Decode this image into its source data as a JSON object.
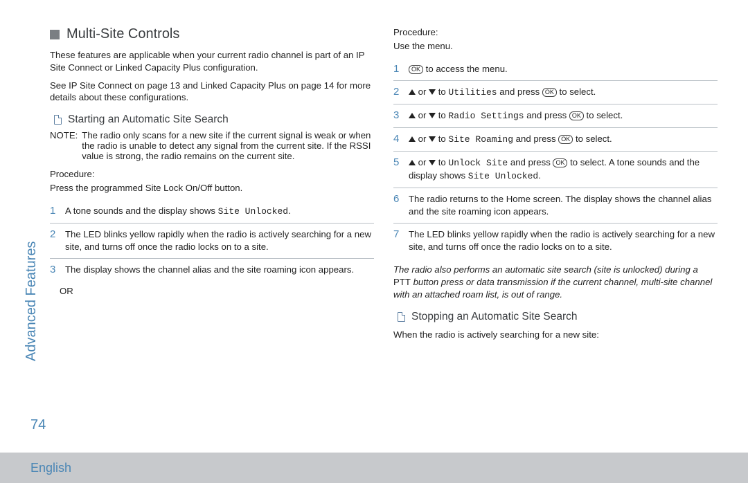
{
  "sidebar_label": "Advanced Features",
  "page_number": "74",
  "footer_language": "English",
  "left": {
    "section_title": "Multi-Site Controls",
    "intro": "These features are applicable when your current radio channel is part of an IP Site Connect or Linked Capacity Plus configuration.",
    "see": "See IP Site Connect   on page 13 and Linked Capacity Plus    on page 14 for more details about these configurations.",
    "sub1_title": "Starting an Automatic Site Search",
    "note_label": "NOTE:",
    "note_text": "The radio only  scans for a new site if the current signal is weak or when the radio is unable to detect any signal from the current site. If the RSSI value is strong, the radio remains on the current site.",
    "procedure_label": "Procedure:",
    "press_line": "Press the programmed Site Lock On/Off   button.",
    "steps": [
      {
        "pre": "A tone sounds and the display shows ",
        "mono": "Site Unlocked",
        "post": "."
      },
      {
        "text": "The LED blinks yellow rapidly when the radio is actively searching for a new site, and turns off once the radio locks on to a site."
      },
      {
        "text": "The display shows the channel alias and the site roaming icon appears."
      }
    ],
    "or_label": "OR"
  },
  "right": {
    "procedure_label": "Procedure:",
    "use_menu": "Use the menu.",
    "step1_post": " to access the menu.",
    "nav_to": " to ",
    "nav_press": " and press ",
    "nav_select": " to select.",
    "nav2_target": "Utilities",
    "nav3_target": "Radio Settings",
    "nav4_target": "Site Roaming",
    "nav5_target": "Unlock Site",
    "nav5_tail_pre": " to select. A tone sounds and the display shows ",
    "nav5_tail_mono": "Site Unlocked",
    "nav5_tail_post": ".",
    "or_word": " or ",
    "step6": "The radio returns to the Home screen. The display shows the channel alias and the site roaming icon appears.",
    "step7": "The LED blinks yellow rapidly when the radio is actively searching for a new site, and turns off once the radio locks on to a site.",
    "italic_pre": "The radio also performs an automatic site search (site is unlocked) during a ",
    "italic_ptt": "PTT",
    "italic_post": " button press or data transmission if the current channel, multi-site channel with an attached roam list, is out of range.",
    "sub2_title": "Stopping an Automatic Site Search",
    "sub2_body": "When the radio is actively searching for a new site:"
  },
  "key_label": "OK"
}
